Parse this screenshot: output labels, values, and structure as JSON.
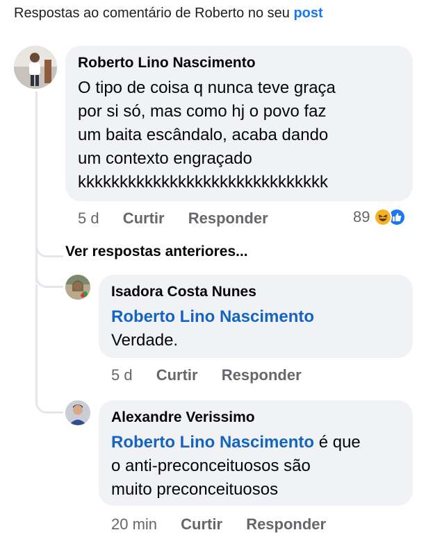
{
  "header": {
    "prefix": "Respostas ao comentário de Roberto no seu",
    "post_link": "post"
  },
  "main_comment": {
    "author": "Roberto Lino Nascimento",
    "lines": [
      "O tipo de coisa q nunca teve graça",
      "por si só, mas como hj o povo faz",
      "um baita escândalo, acaba dando",
      "um contexto engraçado",
      "kkkkkkkkkkkkkkkkkkkkkkkkkkkkkk"
    ],
    "time": "5 d",
    "like_label": "Curtir",
    "reply_label": "Responder",
    "reaction_count": "89",
    "reaction_icons": [
      "haha-icon",
      "like-icon"
    ]
  },
  "see_previous": "Ver respostas anteriores...",
  "replies": [
    {
      "author": "Isadora Costa Nunes",
      "mention": "Roberto Lino Nascimento",
      "mention_suffix": "",
      "lines": [
        "Verdade."
      ],
      "time": "5 d",
      "like_label": "Curtir",
      "reply_label": "Responder"
    },
    {
      "author": "Alexandre Verissimo",
      "mention": "Roberto Lino Nascimento",
      "mention_suffix": " é que",
      "lines": [
        "o anti-preconceituosos são",
        "muito preconceituosos"
      ],
      "time": "20 min",
      "like_label": "Curtir",
      "reply_label": "Responder"
    }
  ],
  "colors": {
    "link_blue": "#1877f2",
    "mention_blue": "#1464c0",
    "bubble_bg": "#f0f2f5",
    "meta_gray": "#65676b"
  }
}
